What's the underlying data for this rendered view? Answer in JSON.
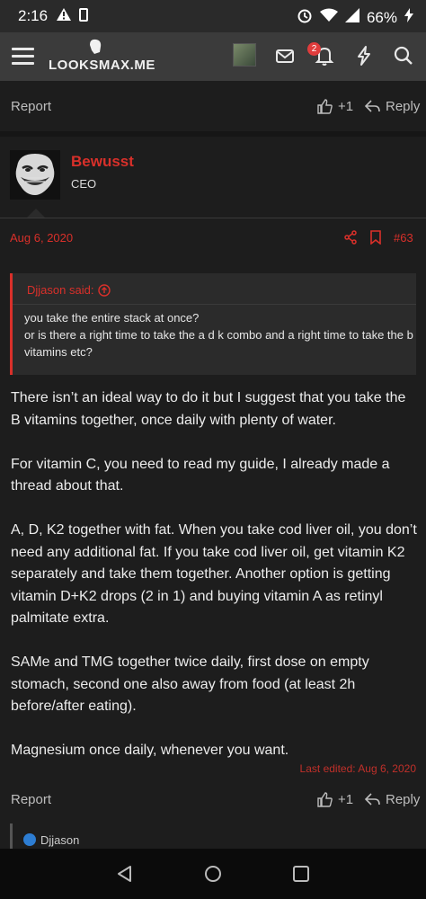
{
  "status_bar": {
    "time": "2:16",
    "battery": "66%"
  },
  "header": {
    "site_name": "LOOKSMAX.ME",
    "notification_count": "2",
    "icons": [
      "menu-icon",
      "mail-icon",
      "bell-icon",
      "bolt-icon",
      "search-icon"
    ]
  },
  "prev_post": {
    "report_label": "Report",
    "like_label": "+1",
    "reply_label": "Reply"
  },
  "post": {
    "username": "Bewusst",
    "user_title": "CEO",
    "date": "Aug 6, 2020",
    "post_number": "#63",
    "quote": {
      "author_label": "Djjason said:",
      "lines": [
        "you take the entire stack at once?",
        "or is there a right time to take the a d k combo and a right time to take the b vitamins etc?"
      ]
    },
    "paragraphs": [
      "There isn’t an ideal way to do it but I suggest that you take the B vitamins together, once daily with plenty of water.",
      "For vitamin C, you need to read my guide, I already made a thread about that.",
      "A, D, K2 together with fat. When you take cod liver oil, you don’t need any additional fat. If you take cod liver oil, get vitamin K2 separately and take them together. Another option is getting vitamin D+K2 drops (2 in 1) and buying vitamin A as retinyl palmitate extra.",
      "SAMe and TMG together twice daily, first dose on empty stomach, second one also away from food (at least 2h before/after eating).",
      "Magnesium once daily, whenever you want."
    ],
    "last_edited": "Last edited: Aug 6, 2020",
    "report_label": "Report",
    "like_label": "+1",
    "reply_label": "Reply",
    "reaction_user": "Djjason"
  },
  "colors": {
    "accent": "#d9302a",
    "background": "#1d1d1d",
    "header": "#3b3b3b",
    "quote_bg": "#2b2b2b",
    "like_blue": "#2d7dd2"
  }
}
